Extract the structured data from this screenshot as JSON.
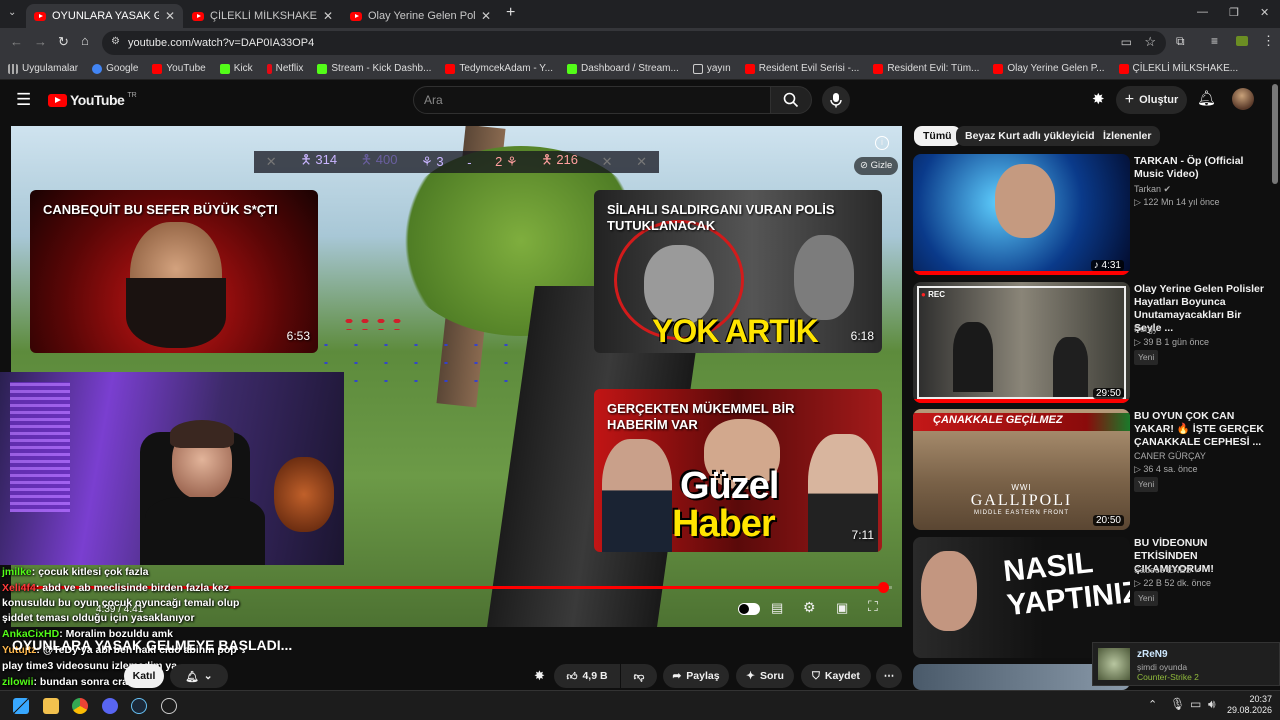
{
  "browser": {
    "tabs": [
      {
        "label": "OYUNLARA YASAK GELMEYE BA"
      },
      {
        "label": "ÇİLEKLİ MİLKSHAKE | Madara O"
      },
      {
        "label": "Olay Yerine Gelen Polisler Haya"
      }
    ],
    "new_tab": "+",
    "url": "youtube.com/watch?v=DAP0IA33OP4",
    "bookmarks": [
      {
        "label": "Uygulamalar",
        "color": "#aaaaaa"
      },
      {
        "label": "Google",
        "color": "#4285f4"
      },
      {
        "label": "YouTube",
        "color": "#ff0000"
      },
      {
        "label": "Kick",
        "color": "#53fc18"
      },
      {
        "label": "Netflix",
        "color": "#e50914"
      },
      {
        "label": "Stream - Kick Dashb...",
        "color": "#53fc18"
      },
      {
        "label": "TedymcekAdam - Y...",
        "color": "#ff0000"
      },
      {
        "label": "Dashboard / Stream...",
        "color": "#53fc18"
      },
      {
        "label": "yayın",
        "color": "#cccccc"
      },
      {
        "label": "Resident Evil Serisi -...",
        "color": "#ff0000"
      },
      {
        "label": "Resident Evil: Tüm...",
        "color": "#ff0000"
      },
      {
        "label": "Olay Yerine Gelen P...",
        "color": "#ff0000"
      },
      {
        "label": "ÇİLEKLİ MİLKSHAKE...",
        "color": "#ff0000"
      }
    ]
  },
  "youtube": {
    "logo": "YouTube",
    "logo_sup": "TR",
    "search_placeholder": "Ara",
    "create_label": "Oluştur",
    "chips": [
      {
        "label": "Tümü"
      },
      {
        "label": "Beyaz Kurt adlı yükleyiciden"
      },
      {
        "label": "İzlenenler"
      }
    ],
    "accent": "#ff0000"
  },
  "player": {
    "hud": {
      "a": "314",
      "b": "400",
      "c": "3",
      "dash": "-",
      "d": "2",
      "e": "216"
    },
    "hide_label": "Gizle",
    "time": "4:39 / 4:41",
    "progress": 0.99,
    "endcards": [
      {
        "title": "CANBEQUİT BU SEFER BÜYÜK S*ÇTI",
        "duration": "6:53"
      },
      {
        "title": "SİLAHLI SALDIRGANI VURAN POLİS TUTUKLANACAK",
        "overlay": "YOK ARTIK",
        "duration": "6:18"
      },
      {
        "title": "GERÇEKTEN MÜKEMMEL BİR HABERİM VAR",
        "overlay1": "Güzel",
        "overlay2": "Haber",
        "duration": "7:11"
      }
    ]
  },
  "video": {
    "title": "OYUNLARA YASAK GELMEYE BAŞLADI...",
    "subscribe_label": "Katıl",
    "likes": "4,9 B",
    "share": "Paylaş",
    "ask": "Soru",
    "save": "Kaydet"
  },
  "chat": [
    {
      "user": "jmilke",
      "text": ": çocuk kitlesi çok fazla"
    },
    {
      "user": "Xeli4f4",
      "text": ": abd ve ab meclisinde birden fazla kez"
    },
    {
      "user": "",
      "text": "konusuldu bu oyun çocuk oyuncağı temalı olup"
    },
    {
      "user": "",
      "text": "şiddet teması olduğu için yasaklanıyor"
    },
    {
      "user": "AnkaCixHD",
      "text": ": Moralim bozuldu amk"
    },
    {
      "user": "Yutujtz",
      "text": ": @TeDy ya abi ben haki cido abinin pop"
    },
    {
      "user": "",
      "text": "play time3 videosunu izlemedim ya"
    },
    {
      "user": "zilowii",
      "text": ": bundan sonra crack mi"
    }
  ],
  "sidebar": [
    {
      "title": "TARKAN - Öp (Official Music Video)",
      "channel": "Tarkan ✔",
      "meta": "▷ 122 Mn  14 yıl önce",
      "badge": "",
      "duration": "♪ 4:31"
    },
    {
      "title": "Olay Yerine Gelen Polisler Hayatları Boyunca Unutamayacakları Bir Şeyle ...",
      "channel": "Purgy",
      "meta": "▷ 39 B  1 gün önce",
      "badge": "Yeni",
      "duration": "29:50",
      "rec": "REC"
    },
    {
      "title": "BU OYUN ÇOK CAN YAKAR! 🔥 İŞTE GERÇEK ÇANAKKALE CEPHESİ ...",
      "channel": "CANER GÜRÇAY",
      "meta": "▷ 36  4 sa. önce",
      "badge": "Yeni",
      "duration": "20:50",
      "overlay": "ÇANAKKALE GEÇİLMEZ",
      "sub": "GALLIPOLI",
      "sub2": "MIDDLE EASTERN FRONT",
      "sub0": "WWI"
    },
    {
      "title": "BU VİDEONUN ETKİSİNDEN ÇIKAMIYORUM!",
      "channel": "Sadece ENES ✔",
      "meta": "▷ 22 B  52 dk. önce",
      "badge": "Yeni",
      "overlay": "NASIL YAPTINIZ?"
    }
  ],
  "toast": {
    "name": "zReN9",
    "status": "şimdi oyunda",
    "game": "Counter-Strike 2"
  },
  "taskbar": {
    "time": "20:37",
    "date": "29.08.2026"
  }
}
